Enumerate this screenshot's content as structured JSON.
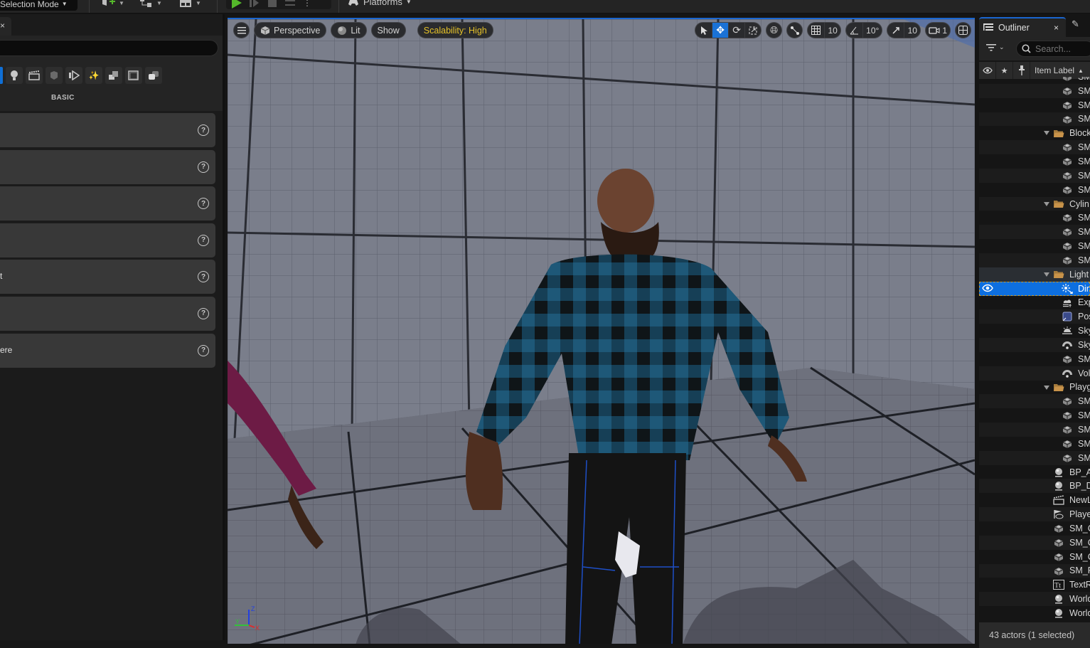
{
  "top_toolbar": {
    "mode_label": "Selection Mode",
    "platforms_label": "Platforms",
    "icons": [
      "add-content-icon",
      "blueprint-icon",
      "cinematics-icon",
      "play-icon",
      "advance-frame-icon",
      "stop-icon",
      "eject-icon",
      "more-options-icon",
      "platforms-icon"
    ]
  },
  "place_actors": {
    "tab_close": "×",
    "search_placeholder": "",
    "categories": [
      "recently-placed",
      "lights",
      "cinematic",
      "visual-effects-volume",
      "geometry",
      "basic-shapes",
      "volumes",
      "all-classes",
      "placeholder"
    ],
    "section_label": "BASIC",
    "items": [
      {
        "label": ""
      },
      {
        "label": ""
      },
      {
        "label": ""
      },
      {
        "label": ""
      },
      {
        "label": "t"
      },
      {
        "label": ""
      },
      {
        "label": "ere"
      }
    ],
    "help_glyph": "?"
  },
  "viewport": {
    "toolbar": {
      "menu_icon": "hamburger-menu-icon",
      "perspective_label": "Perspective",
      "lit_label": "Lit",
      "show_label": "Show",
      "scalability_label": "Scalability: High",
      "scalability_color": "#e6c228"
    },
    "transform_tools": [
      {
        "name": "select",
        "active": false
      },
      {
        "name": "translate",
        "active": true
      },
      {
        "name": "rotate",
        "active": false
      },
      {
        "name": "scale",
        "active": false
      }
    ],
    "grid_snap_value": "10",
    "rotation_snap_value": "10°",
    "scale_snap_value": "10",
    "camera_speed_value": "1",
    "active_color": "#1a72d6",
    "gizmo_axes": {
      "x": "X",
      "y": "Y",
      "z": "Z"
    }
  },
  "outliner": {
    "tab_label": "Outliner",
    "close_glyph": "×",
    "search_placeholder": "Search...",
    "columns": {
      "label": "Item Label",
      "sort": "▲"
    },
    "rows": [
      {
        "type": "mesh",
        "label": "SM",
        "indent": 2
      },
      {
        "type": "mesh",
        "label": "SM",
        "indent": 2
      },
      {
        "type": "mesh",
        "label": "SM",
        "indent": 2
      },
      {
        "type": "mesh",
        "label": "SM",
        "indent": 2
      },
      {
        "type": "folder",
        "label": "Block",
        "indent": 1
      },
      {
        "type": "mesh",
        "label": "SM",
        "indent": 2
      },
      {
        "type": "mesh",
        "label": "SM",
        "indent": 2
      },
      {
        "type": "mesh",
        "label": "SM",
        "indent": 2
      },
      {
        "type": "mesh",
        "label": "SM",
        "indent": 2
      },
      {
        "type": "folder",
        "label": "Cylin",
        "indent": 1
      },
      {
        "type": "mesh",
        "label": "SM",
        "indent": 2
      },
      {
        "type": "mesh",
        "label": "SM",
        "indent": 2
      },
      {
        "type": "mesh",
        "label": "SM",
        "indent": 2
      },
      {
        "type": "mesh",
        "label": "SM",
        "indent": 2
      },
      {
        "type": "folder",
        "label": "Light",
        "indent": 1,
        "highlight": true
      },
      {
        "type": "dirlight",
        "label": "Dir",
        "indent": 2,
        "selected": true
      },
      {
        "type": "fog",
        "label": "Exp",
        "indent": 2
      },
      {
        "type": "postprocess",
        "label": "Pos",
        "indent": 2
      },
      {
        "type": "skyatmo",
        "label": "Sky",
        "indent": 2
      },
      {
        "type": "skylight",
        "label": "Sky",
        "indent": 2
      },
      {
        "type": "mesh",
        "label": "SM",
        "indent": 2
      },
      {
        "type": "skylight",
        "label": "Vol",
        "indent": 2
      },
      {
        "type": "folder",
        "label": "Playg",
        "indent": 1
      },
      {
        "type": "mesh",
        "label": "SM",
        "indent": 2
      },
      {
        "type": "mesh",
        "label": "SM",
        "indent": 2
      },
      {
        "type": "mesh",
        "label": "SM",
        "indent": 2
      },
      {
        "type": "mesh",
        "label": "SM",
        "indent": 2
      },
      {
        "type": "mesh",
        "label": "SM",
        "indent": 2
      },
      {
        "type": "actor",
        "label": "BP_A",
        "indent": 1
      },
      {
        "type": "actor",
        "label": "BP_D",
        "indent": 1
      },
      {
        "type": "sequence",
        "label": "NewL",
        "indent": 1
      },
      {
        "type": "playerstart",
        "label": "Playe",
        "indent": 1
      },
      {
        "type": "mesh",
        "label": "SM_C",
        "indent": 1
      },
      {
        "type": "mesh",
        "label": "SM_C",
        "indent": 1
      },
      {
        "type": "mesh",
        "label": "SM_C",
        "indent": 1
      },
      {
        "type": "mesh",
        "label": "SM_F",
        "indent": 1
      },
      {
        "type": "text",
        "label": "TextR",
        "indent": 1
      },
      {
        "type": "actor",
        "label": "World",
        "indent": 1
      },
      {
        "type": "actor",
        "label": "World",
        "indent": 1
      }
    ],
    "footer": "43 actors (1 selected)",
    "selection_color": "#0d6fe0",
    "folder_color": "#c8934a"
  }
}
